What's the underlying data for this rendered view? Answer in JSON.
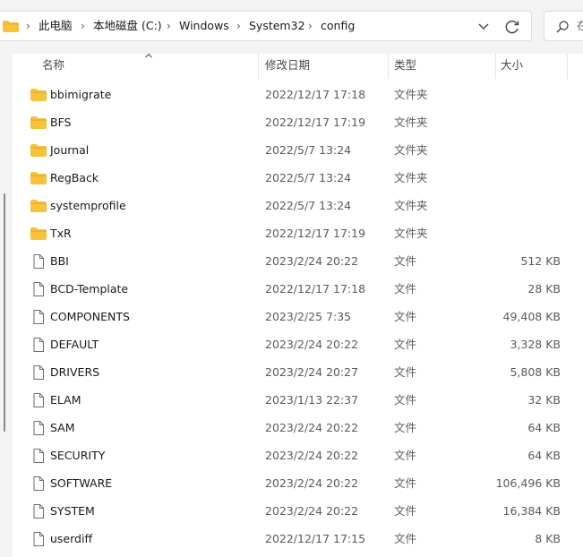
{
  "address_bar": {
    "breadcrumbs": [
      "此电脑",
      "本地磁盘 (C:)",
      "Windows",
      "System32",
      "config"
    ],
    "separator": "›"
  },
  "search": {
    "placeholder": "在"
  },
  "columns": {
    "name": "名称",
    "modified": "修改日期",
    "type": "类型",
    "size": "大小"
  },
  "files": [
    {
      "name": "bbimigrate",
      "modified": "2022/12/17 17:18",
      "type": "文件夹",
      "size": "",
      "kind": "folder"
    },
    {
      "name": "BFS",
      "modified": "2022/12/17 17:19",
      "type": "文件夹",
      "size": "",
      "kind": "folder"
    },
    {
      "name": "Journal",
      "modified": "2022/5/7 13:24",
      "type": "文件夹",
      "size": "",
      "kind": "folder"
    },
    {
      "name": "RegBack",
      "modified": "2022/5/7 13:24",
      "type": "文件夹",
      "size": "",
      "kind": "folder"
    },
    {
      "name": "systemprofile",
      "modified": "2022/5/7 13:24",
      "type": "文件夹",
      "size": "",
      "kind": "folder"
    },
    {
      "name": "TxR",
      "modified": "2022/12/17 17:19",
      "type": "文件夹",
      "size": "",
      "kind": "folder"
    },
    {
      "name": "BBI",
      "modified": "2023/2/24 20:22",
      "type": "文件",
      "size": "512 KB",
      "kind": "file"
    },
    {
      "name": "BCD-Template",
      "modified": "2022/12/17 17:18",
      "type": "文件",
      "size": "28 KB",
      "kind": "file"
    },
    {
      "name": "COMPONENTS",
      "modified": "2023/2/25 7:35",
      "type": "文件",
      "size": "49,408 KB",
      "kind": "file"
    },
    {
      "name": "DEFAULT",
      "modified": "2023/2/24 20:22",
      "type": "文件",
      "size": "3,328 KB",
      "kind": "file"
    },
    {
      "name": "DRIVERS",
      "modified": "2023/2/24 20:27",
      "type": "文件",
      "size": "5,808 KB",
      "kind": "file"
    },
    {
      "name": "ELAM",
      "modified": "2023/1/13 22:37",
      "type": "文件",
      "size": "32 KB",
      "kind": "file"
    },
    {
      "name": "SAM",
      "modified": "2023/2/24 20:22",
      "type": "文件",
      "size": "64 KB",
      "kind": "file"
    },
    {
      "name": "SECURITY",
      "modified": "2023/2/24 20:22",
      "type": "文件",
      "size": "64 KB",
      "kind": "file"
    },
    {
      "name": "SOFTWARE",
      "modified": "2023/2/24 20:22",
      "type": "文件",
      "size": "106,496 KB",
      "kind": "file"
    },
    {
      "name": "SYSTEM",
      "modified": "2023/2/24 20:22",
      "type": "文件",
      "size": "16,384 KB",
      "kind": "file"
    },
    {
      "name": "userdiff",
      "modified": "2022/12/17 17:15",
      "type": "文件",
      "size": "8 KB",
      "kind": "file"
    }
  ],
  "icons": {
    "folder": "folder-icon",
    "file": "file-icon",
    "dropdown": "chevron-down-icon",
    "refresh": "refresh-icon",
    "search": "search-icon",
    "sort": "sort-ascending-icon"
  },
  "colors": {
    "folder_yellow": "#f7c33d",
    "folder_tab": "#e4a82a",
    "chrome_bg": "#f3f3f3"
  }
}
